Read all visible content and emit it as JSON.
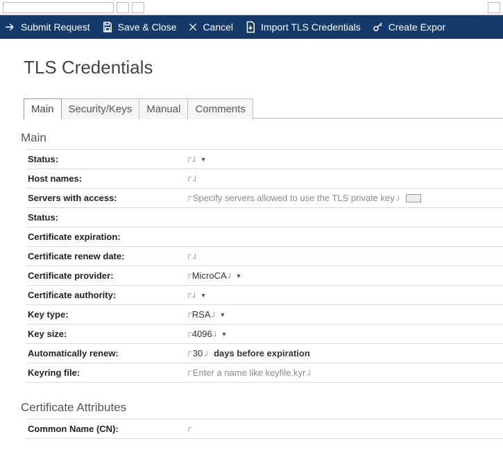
{
  "actions": {
    "submit": "Submit Request",
    "save_close": "Save & Close",
    "cancel": "Cancel",
    "import_tls": "Import TLS Credentials",
    "create_export": "Create Expor"
  },
  "page_title": "TLS Credentials",
  "tabs": {
    "main": "Main",
    "security": "Security/Keys",
    "manual": "Manual",
    "comments": "Comments"
  },
  "section_main_title": "Main",
  "fields": {
    "status1_label": "Status:",
    "hostnames_label": "Host names:",
    "servers_label": "Servers with access:",
    "servers_placeholder": "Specify servers allowed to use the TLS private key",
    "status2_label": "Status:",
    "cert_exp_label": "Certificate expiration:",
    "cert_renew_label": "Certificate renew date:",
    "cert_provider_label": "Certificate provider:",
    "cert_provider_value": "MicroCA",
    "cert_authority_label": "Certificate authority:",
    "key_type_label": "Key type:",
    "key_type_value": "RSA",
    "key_size_label": "Key size:",
    "key_size_value": "4096",
    "auto_renew_label": "Automatically renew:",
    "auto_renew_value": "30",
    "auto_renew_suffix": "days before expiration",
    "keyring_label": "Keyring file:",
    "keyring_placeholder": "Enter a name like keyfile.kyr"
  },
  "section_cert_attrs_title": "Certificate Attributes",
  "cert_attrs": {
    "cn_label": "Common Name (CN):"
  }
}
